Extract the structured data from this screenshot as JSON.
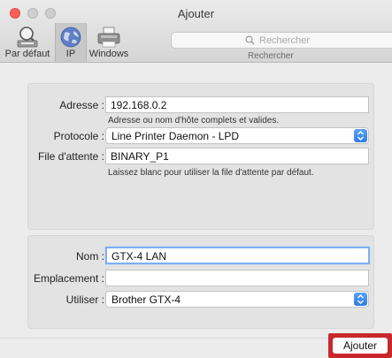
{
  "window": {
    "title": "Ajouter"
  },
  "toolbar": {
    "items": [
      {
        "label": "Par défaut",
        "icon": "default-printer-icon"
      },
      {
        "label": "IP",
        "icon": "globe-icon",
        "selected": true
      },
      {
        "label": "Windows",
        "icon": "windows-printer-icon"
      }
    ],
    "search": {
      "placeholder": "Rechercher",
      "label": "Rechercher"
    }
  },
  "ip_section": {
    "address": {
      "label": "Adresse :",
      "value": "192.168.0.2",
      "hint": "Adresse ou nom d'hôte complets et valides."
    },
    "protocol": {
      "label": "Protocole :",
      "value": "Line Printer Daemon - LPD"
    },
    "queue": {
      "label": "File d'attente :",
      "value": "BINARY_P1",
      "hint": "Laissez blanc pour utiliser la file d'attente par défaut."
    }
  },
  "info_section": {
    "name": {
      "label": "Nom :",
      "value": "GTX-4 LAN"
    },
    "location": {
      "label": "Emplacement :",
      "value": ""
    },
    "use": {
      "label": "Utiliser :",
      "value": "Brother GTX-4"
    }
  },
  "footer": {
    "add_label": "Ajouter"
  },
  "colors": {
    "accent": "#2f7ce8",
    "close": "#fc5f57",
    "highlight": "#c8282c",
    "focus": "#7cb0f3"
  }
}
